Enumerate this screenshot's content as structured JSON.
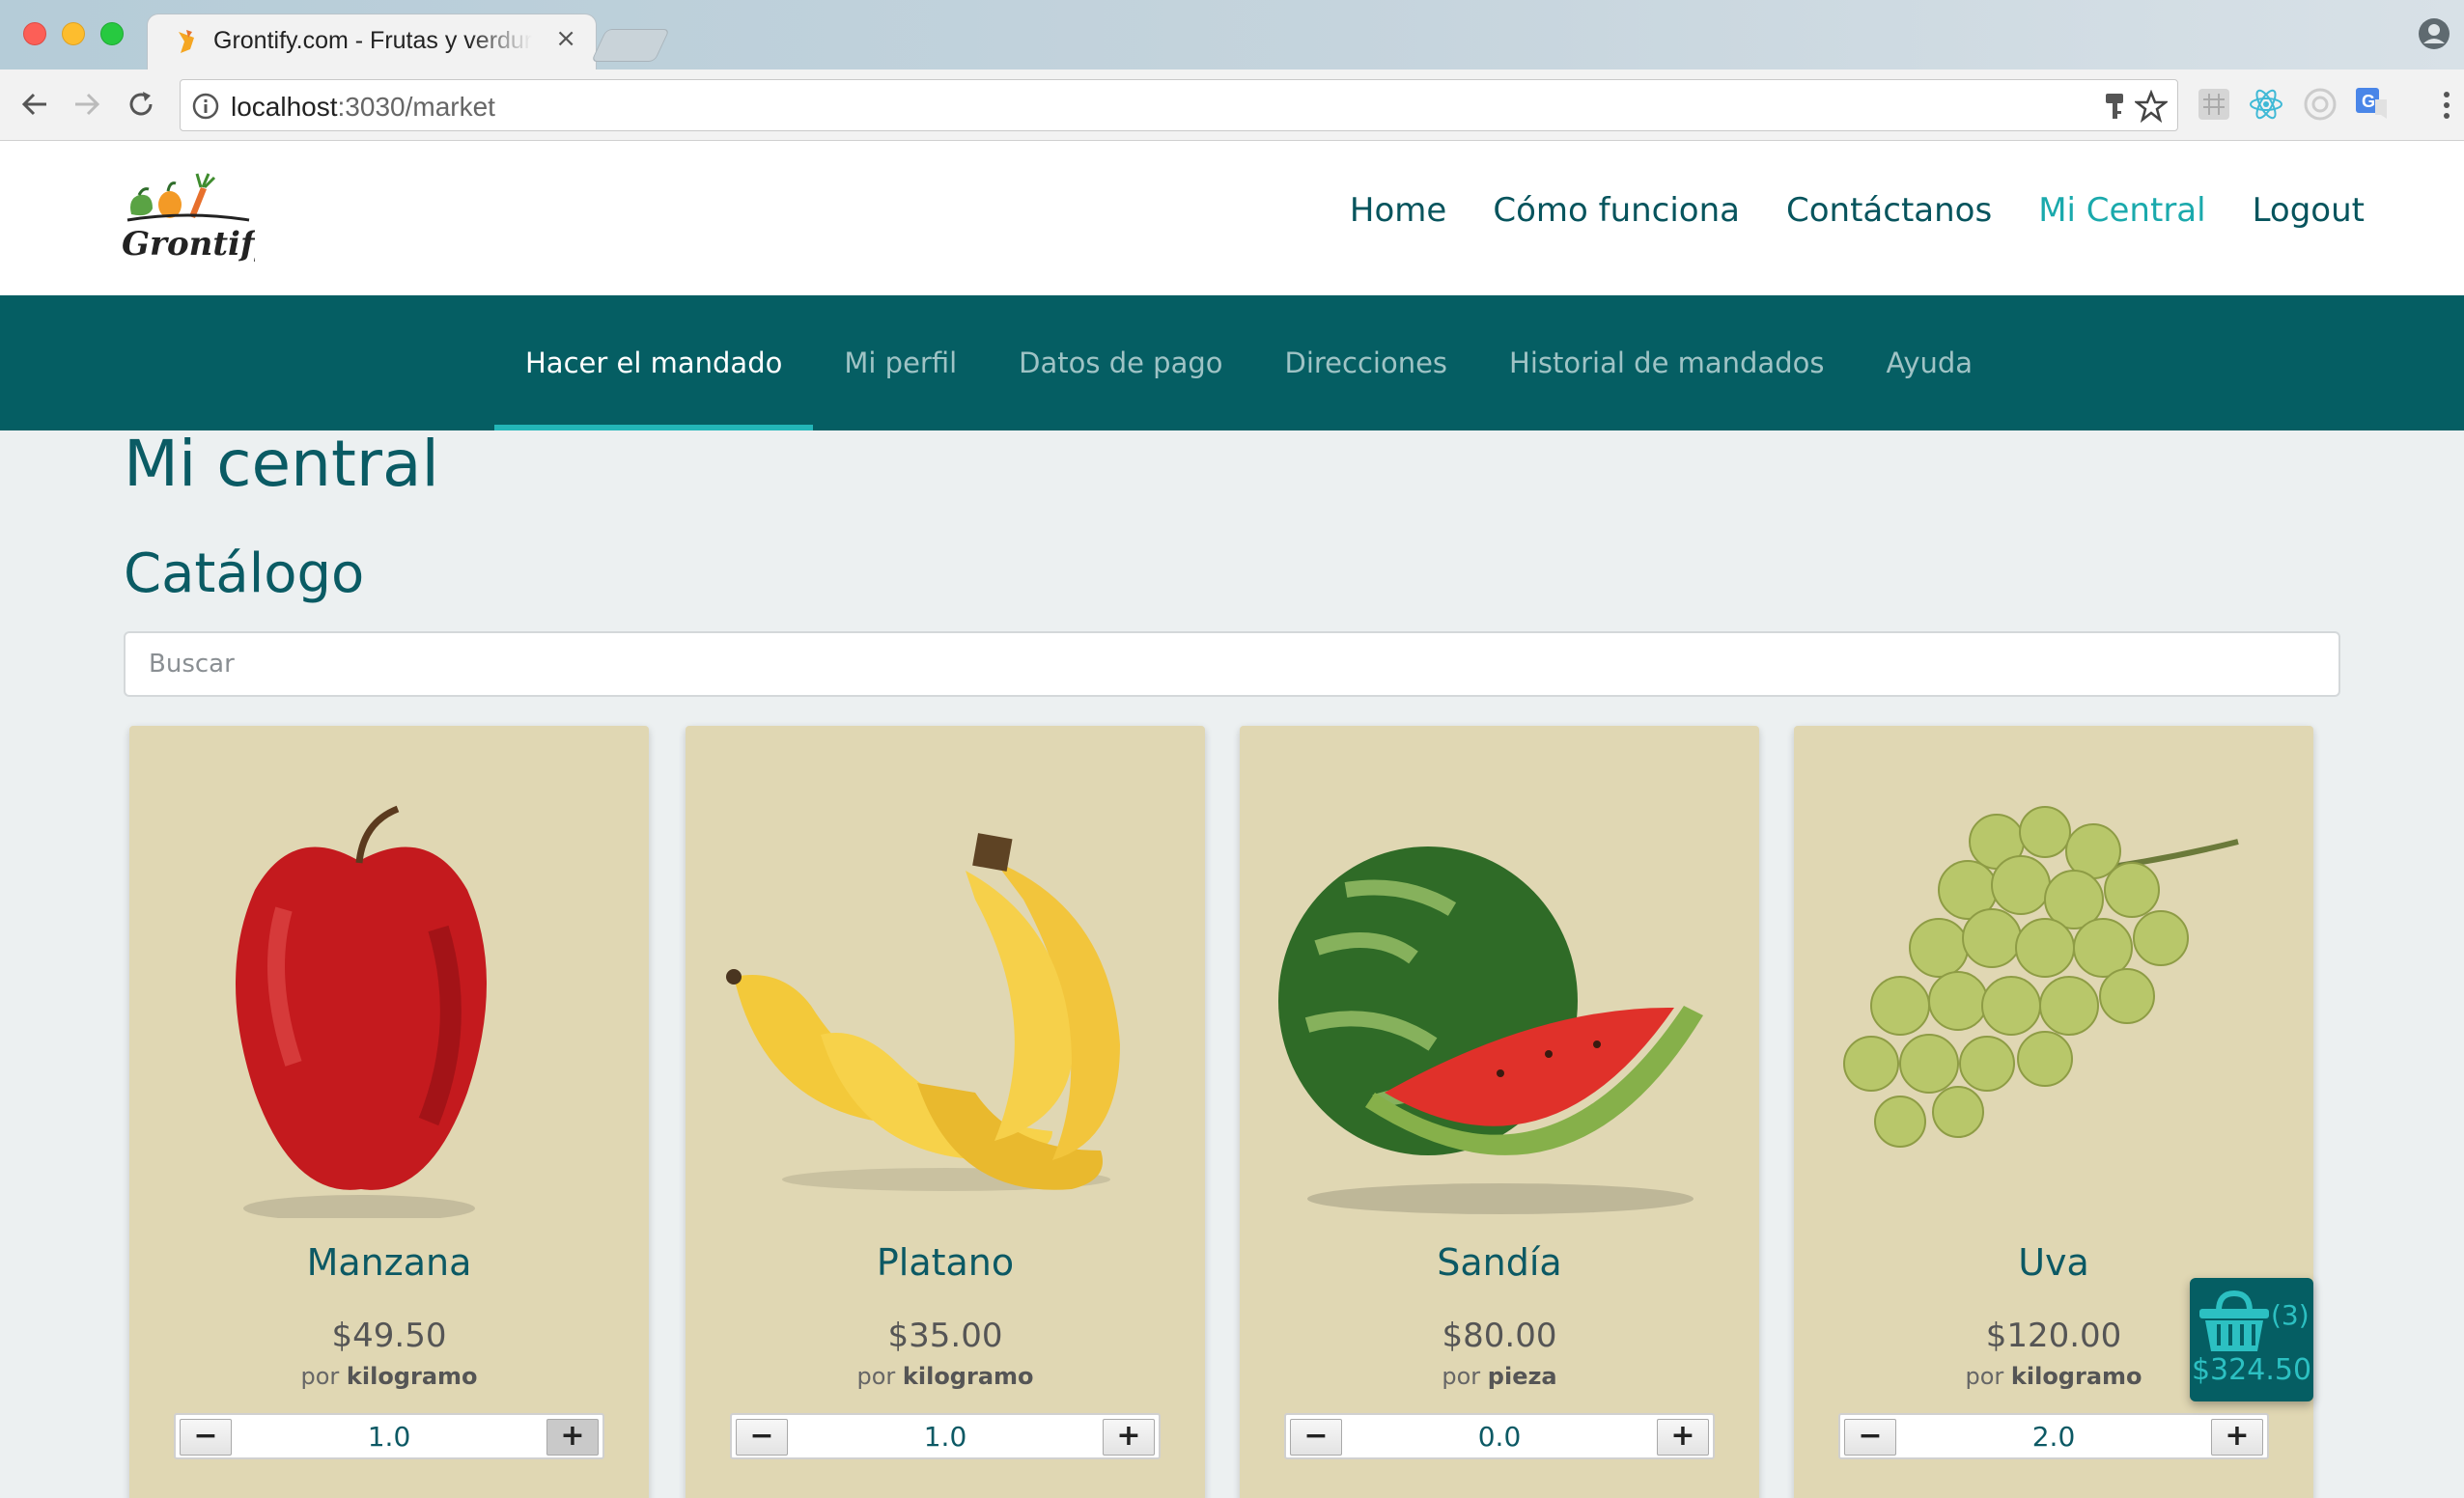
{
  "browser": {
    "tab_title": "Grontify.com - Frutas y verduras",
    "tab_close": "×",
    "url_host": "localhost",
    "url_rest": ":3030/market"
  },
  "header": {
    "logo_text": "Grontify",
    "nav": [
      {
        "label": "Home"
      },
      {
        "label": "Cómo funciona"
      },
      {
        "label": "Contáctanos"
      },
      {
        "label": "Mi Central",
        "active": true
      },
      {
        "label": "Logout"
      }
    ]
  },
  "subnav": {
    "items": [
      {
        "label": "Hacer el mandado",
        "active": true
      },
      {
        "label": "Mi perfil"
      },
      {
        "label": "Datos de pago"
      },
      {
        "label": "Direcciones"
      },
      {
        "label": "Historial de mandados"
      },
      {
        "label": "Ayuda"
      }
    ]
  },
  "main": {
    "title": "Mi central",
    "catalog_title": "Catálogo",
    "search_placeholder": "Buscar"
  },
  "products": [
    {
      "name": "Manzana",
      "price": "$49.50",
      "unit_prefix": "por",
      "unit": "kilogramo",
      "quantity": "1.0",
      "minus": "−",
      "plus": "+",
      "image": "apple"
    },
    {
      "name": "Platano",
      "price": "$35.00",
      "unit_prefix": "por",
      "unit": "kilogramo",
      "quantity": "1.0",
      "minus": "−",
      "plus": "+",
      "image": "banana"
    },
    {
      "name": "Sandía",
      "price": "$80.00",
      "unit_prefix": "por",
      "unit": "pieza",
      "quantity": "0.0",
      "minus": "−",
      "plus": "+",
      "image": "watermelon"
    },
    {
      "name": "Uva",
      "price": "$120.00",
      "unit_prefix": "por",
      "unit": "kilogramo",
      "quantity": "2.0",
      "minus": "−",
      "plus": "+",
      "image": "grapes"
    }
  ],
  "cart": {
    "count": "(3)",
    "total": "$324.50"
  },
  "colors": {
    "brand_teal": "#055e63",
    "accent": "#1aa9ac",
    "card_bg": "#e0d7b3"
  }
}
